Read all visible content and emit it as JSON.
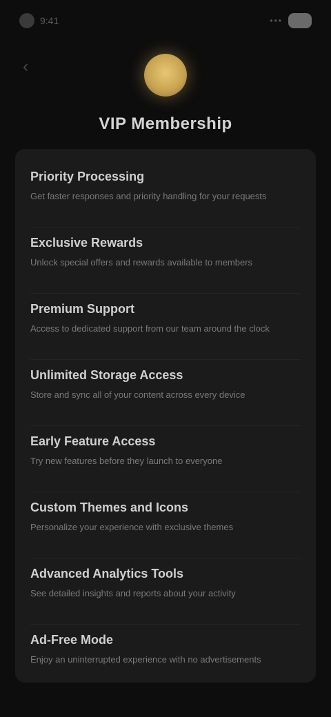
{
  "status_bar": {
    "time": "9:41",
    "signal": "•••",
    "icons": [
      "camera-dot-icon",
      "signal-icon",
      "battery-icon"
    ]
  },
  "nav": {
    "back_icon": "chevron-left-icon",
    "back_glyph": "‹"
  },
  "hero": {
    "icon": "gold-coin-icon",
    "title": "VIP Membership"
  },
  "colors": {
    "background": "#0d0d0d",
    "panel": "#1b1b1b",
    "accent_gold": "#d4b05a"
  },
  "settings": [
    {
      "title": "Priority Processing",
      "description": "Get faster responses and priority handling for your requests"
    },
    {
      "title": "Exclusive Rewards",
      "description": "Unlock special offers and rewards available to members"
    },
    {
      "title": "Premium Support",
      "description": "Access to dedicated support from our team around the clock"
    },
    {
      "title": "Unlimited Storage Access",
      "description": "Store and sync all of your content across every device"
    },
    {
      "title": "Early Feature Access",
      "description": "Try new features before they launch to everyone"
    },
    {
      "title": "Custom Themes and Icons",
      "description": "Personalize your experience with exclusive themes"
    },
    {
      "title": "Advanced Analytics Tools",
      "description": "See detailed insights and reports about your activity"
    },
    {
      "title": "Ad-Free Mode",
      "description": "Enjoy an uninterrupted experience with no advertisements"
    }
  ]
}
